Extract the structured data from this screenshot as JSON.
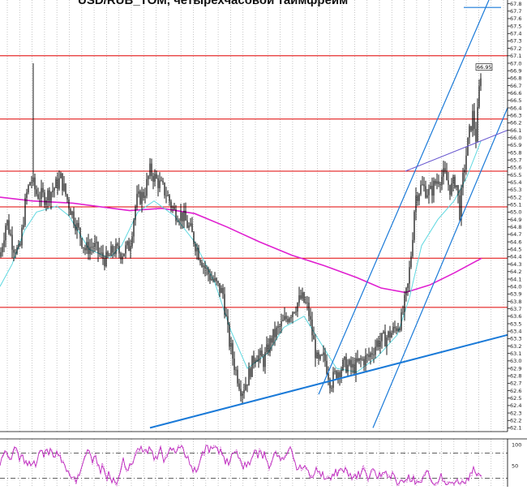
{
  "chart_data": {
    "type": "candlestick",
    "title": "USD/RUB_TOM, четырехчасовой таймфрейм",
    "price_axis": {
      "ticks": [
        "62.1",
        "62.2",
        "62.3",
        "62.4",
        "62.5",
        "62.6",
        "62.7",
        "62.8",
        "62.9",
        "63.0",
        "63.1",
        "63.2",
        "63.3",
        "63.4",
        "63.5",
        "63.6",
        "63.7",
        "63.8",
        "63.9",
        "64.0",
        "64.1",
        "64.2",
        "64.3",
        "64.4",
        "64.5",
        "64.6",
        "64.7",
        "64.8",
        "64.9",
        "65.0",
        "65.1",
        "65.2",
        "65.3",
        "65.4",
        "65.5",
        "65.6",
        "65.7",
        "65.8",
        "65.9",
        "66.0",
        "66.1",
        "66.2",
        "66.3",
        "66.4",
        "66.5",
        "66.6",
        "66.7",
        "66.8",
        "66.9",
        "67.0",
        "67.1",
        "67.2",
        "67.3",
        "67.4",
        "67.5",
        "67.6",
        "67.7",
        "67.8"
      ],
      "range": [
        62.05,
        67.85
      ]
    },
    "last_price": "66.95",
    "levels": [
      67.1,
      66.25,
      65.55,
      65.07,
      64.38,
      63.72
    ],
    "colors": {
      "candles": "#000000",
      "levels": "#e00000",
      "channels": "#1a7ad8",
      "ma_fast": "#5fd8e0",
      "ma_slow": "#e020d0",
      "thin_line": "#6a5ad0",
      "oscillator": "#c030c0",
      "grid": "#b8b8b8"
    },
    "moving_average_slow": [
      [
        0,
        65.2
      ],
      [
        40,
        65.15
      ],
      [
        90,
        65.12
      ],
      [
        160,
        65.02
      ],
      [
        200,
        65.05
      ],
      [
        240,
        64.98
      ],
      [
        280,
        64.8
      ],
      [
        320,
        64.6
      ],
      [
        360,
        64.42
      ],
      [
        400,
        64.28
      ],
      [
        440,
        64.12
      ],
      [
        470,
        63.98
      ],
      [
        500,
        63.92
      ],
      [
        530,
        64.02
      ],
      [
        560,
        64.18
      ],
      [
        594,
        64.38
      ]
    ],
    "moving_average_fast": [
      [
        0,
        64.0
      ],
      [
        15,
        64.3
      ],
      [
        30,
        64.75
      ],
      [
        45,
        65.0
      ],
      [
        70,
        65.08
      ],
      [
        85,
        64.95
      ],
      [
        110,
        64.5
      ],
      [
        135,
        64.38
      ],
      [
        150,
        64.55
      ],
      [
        170,
        65.0
      ],
      [
        190,
        65.15
      ],
      [
        215,
        64.95
      ],
      [
        240,
        64.6
      ],
      [
        265,
        64.05
      ],
      [
        285,
        63.4
      ],
      [
        305,
        62.9
      ],
      [
        330,
        63.1
      ],
      [
        350,
        63.45
      ],
      [
        375,
        63.6
      ],
      [
        395,
        63.25
      ],
      [
        415,
        62.9
      ],
      [
        440,
        62.85
      ],
      [
        465,
        63.05
      ],
      [
        490,
        63.35
      ],
      [
        505,
        63.85
      ],
      [
        520,
        64.55
      ],
      [
        540,
        64.9
      ],
      [
        560,
        65.15
      ],
      [
        575,
        65.45
      ],
      [
        593,
        65.95
      ]
    ],
    "oscillator": {
      "ticks": [
        "100",
        "50"
      ],
      "range": [
        0,
        100
      ],
      "dashed_levels": [
        80,
        20
      ]
    }
  }
}
